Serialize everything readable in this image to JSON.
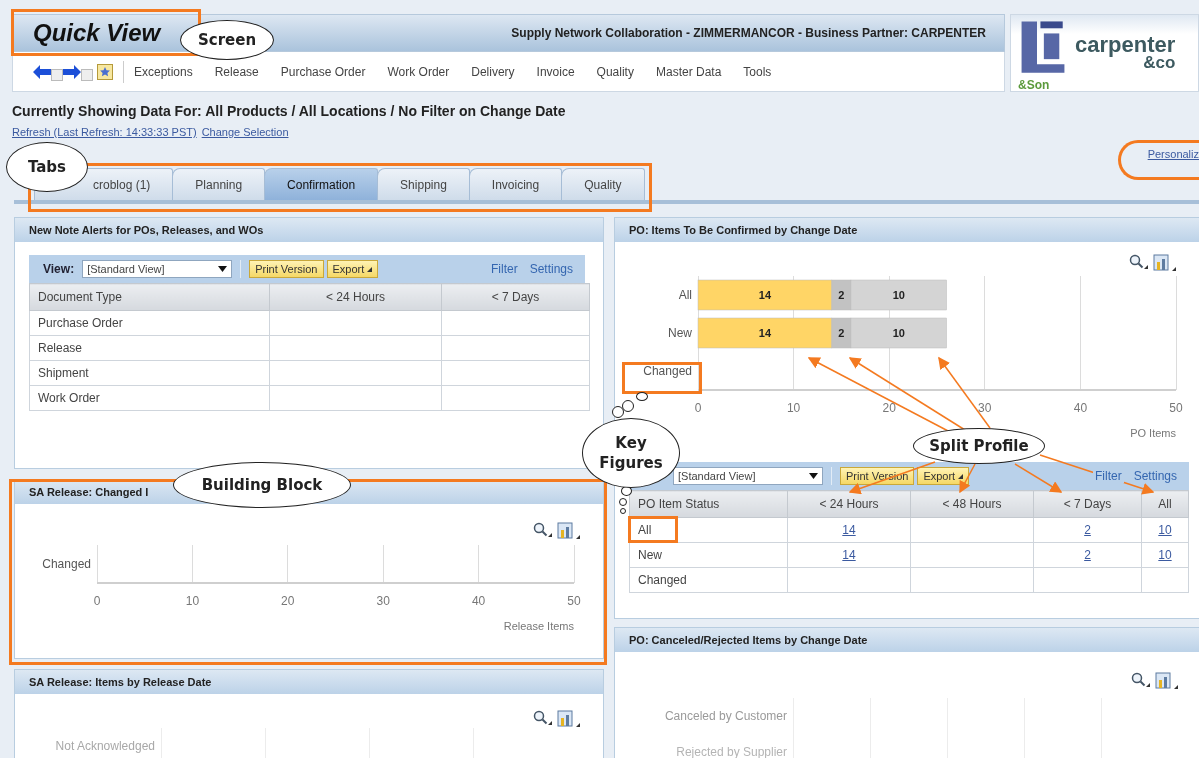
{
  "header": {
    "title": "Quick View",
    "context": "Supply Network Collaboration - ZIMMERMANCOR - Business Partner: CARPENTER"
  },
  "logo": {
    "name": "carpenter",
    "suffix": "&co",
    "tag": "&Son"
  },
  "nav": {
    "items": [
      "Exceptions",
      "Release",
      "Purchase Order",
      "Work Order",
      "Delivery",
      "Invoice",
      "Quality",
      "Master Data",
      "Tools"
    ]
  },
  "selection": {
    "heading": "Currently Showing Data For: All Products / All Locations / No Filter on Change Date",
    "links": [
      "Refresh (Last Refresh: 14:33:33 PST)",
      "Change Selection"
    ]
  },
  "personalize_link": "Personaliz",
  "tabs": [
    {
      "label": "croblog (1)",
      "selected": false
    },
    {
      "label": "Planning",
      "selected": false
    },
    {
      "label": "Confirmation",
      "selected": true
    },
    {
      "label": "Shipping",
      "selected": false
    },
    {
      "label": "Invoicing",
      "selected": false
    },
    {
      "label": "Quality",
      "selected": false
    }
  ],
  "panels_left": [
    {
      "kind": "table",
      "title": "New Note Alerts for POs, Releases, and WOs",
      "toolbar": {
        "view_label": "View:",
        "view_value": "[Standard View]",
        "buttons": [
          "Print Version",
          "Export"
        ],
        "links": [
          "Filter",
          "Settings"
        ]
      },
      "columns": [
        "Document Type",
        "< 24 Hours",
        "< 7 Days"
      ],
      "rows": [
        [
          "Purchase Order",
          "",
          ""
        ],
        [
          "Release",
          "",
          ""
        ],
        [
          "Shipment",
          "",
          ""
        ],
        [
          "Work Order",
          "",
          ""
        ]
      ]
    },
    {
      "kind": "empty_chart",
      "title": "SA Release: Changed I",
      "row_labels": [
        "Changed"
      ],
      "axis_ticks": [
        "0",
        "10",
        "20",
        "30",
        "40",
        "50"
      ],
      "axis_title": "Release Items"
    },
    {
      "kind": "chart_picture",
      "title": "SA Release: Items by Release Date",
      "row_labels": [
        "Not Acknowledged"
      ]
    }
  ],
  "panels_right": [
    {
      "kind": "chart_table",
      "title": "PO: Items To Be Confirmed by Change Date",
      "chart_data": {
        "type": "bar",
        "orientation": "horizontal",
        "grid": true,
        "stacked": true,
        "data_labels": true,
        "categories": [
          "All",
          "New",
          "Changed"
        ],
        "series": [
          {
            "color": "#ffd566",
            "values": [
              14,
              14,
              null
            ]
          },
          {
            "color": "#c2c2c2",
            "values": [
              2,
              2,
              null
            ]
          },
          {
            "color": "#d4d4d4",
            "values": [
              10,
              10,
              null
            ]
          }
        ],
        "xlabel": "PO Items",
        "xlim": [
          0,
          50
        ],
        "xticks": [
          0,
          10,
          20,
          30,
          40,
          50
        ]
      },
      "toolbar": {
        "view_value": "[Standard View]",
        "buttons": [
          "Print Version",
          "Export"
        ],
        "links": [
          "Filter",
          "Settings"
        ]
      },
      "columns": [
        "PO Item Status",
        "< 24 Hours",
        "< 48 Hours",
        "< 7 Days",
        "All"
      ],
      "rows": [
        [
          "All",
          "14",
          "",
          "2",
          "10"
        ],
        [
          "New",
          "14",
          "",
          "2",
          "10"
        ],
        [
          "Changed",
          "",
          "",
          "",
          ""
        ]
      ]
    },
    {
      "kind": "chart_picture",
      "title": "PO: Canceled/Rejected Items by Change Date",
      "row_labels": [
        "Canceled by Customer",
        "Rejected by Supplier"
      ]
    }
  ],
  "callouts": [
    "Screen",
    "Tabs",
    "Building Block",
    "Key Figures",
    "Split Profile"
  ]
}
